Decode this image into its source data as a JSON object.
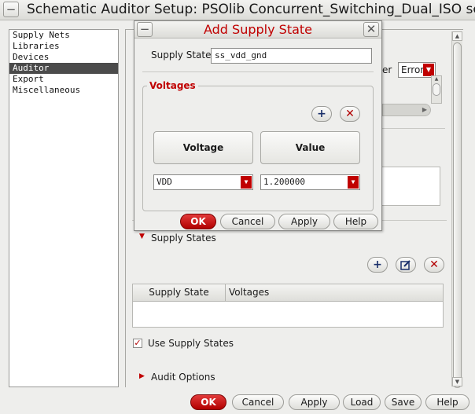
{
  "window": {
    "title": "Schematic Auditor Setup: PSOlib Concurrent_Switching_Dual_ISO sch",
    "icon_left": "minimize-icon",
    "icon_right": "close-icon"
  },
  "nav": {
    "items": [
      {
        "label": "Supply Nets",
        "selected": false
      },
      {
        "label": "Libraries",
        "selected": false
      },
      {
        "label": "Devices",
        "selected": false
      },
      {
        "label": "Auditor",
        "selected": true
      },
      {
        "label": "Export",
        "selected": false
      },
      {
        "label": "Miscellaneous",
        "selected": false
      }
    ]
  },
  "auditor_panel": {
    "partial_label": "er",
    "severity_value": "Error",
    "supply_states_heading": "Supply States",
    "table_headers": [
      "Supply State",
      "Voltages"
    ],
    "use_supply_states_label": "Use Supply States",
    "use_supply_states_checked": true,
    "audit_options_heading": "Audit Options"
  },
  "main_buttons": {
    "ok": "OK",
    "cancel": "Cancel",
    "apply": "Apply",
    "load": "Load",
    "save": "Save",
    "help": "Help"
  },
  "dialog": {
    "title": "Add Supply State",
    "supply_state_label": "Supply State",
    "supply_state_value": "ss_vdd_gnd",
    "voltages_heading": "Voltages",
    "col_voltage": "Voltage",
    "col_value": "Value",
    "voltage_select": "VDD",
    "value_select": "1.200000",
    "buttons": {
      "ok": "OK",
      "cancel": "Cancel",
      "apply": "Apply",
      "help": "Help"
    }
  },
  "colors": {
    "accent_red": "#c00000",
    "selection": "#4b4b4b"
  }
}
